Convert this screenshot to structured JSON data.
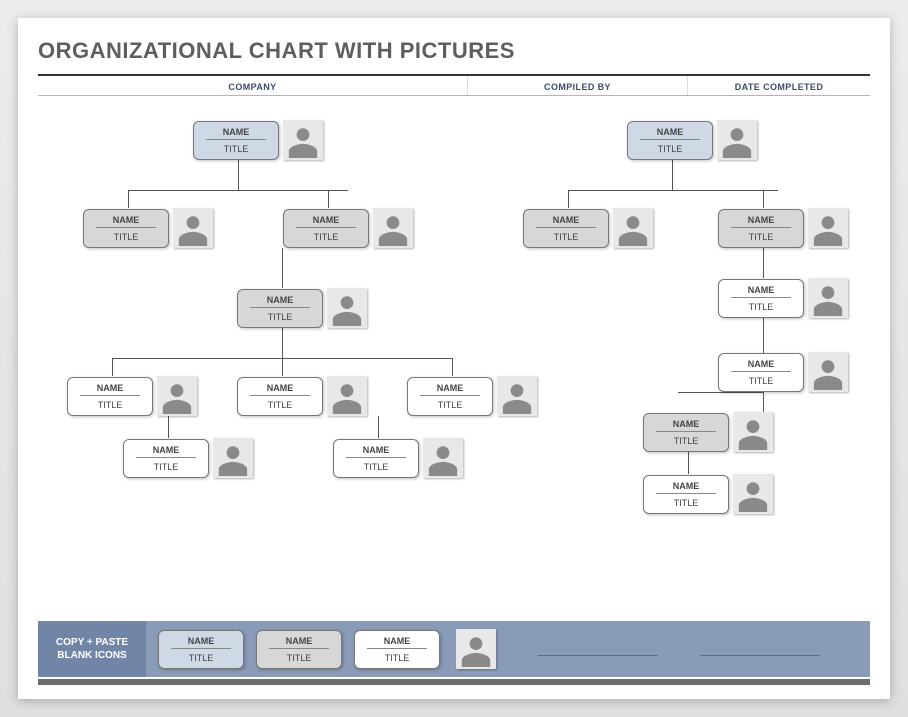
{
  "title": "ORGANIZATIONAL CHART WITH PICTURES",
  "header": {
    "company": "COMPANY",
    "compiled_by": "COMPILED BY",
    "date_completed": "DATE COMPLETED"
  },
  "labels": {
    "name": "NAME",
    "title": "TITLE"
  },
  "nodes": {
    "left_top": {
      "name": "NAME",
      "title": "TITLE"
    },
    "left_l2a": {
      "name": "NAME",
      "title": "TITLE"
    },
    "left_l2b": {
      "name": "NAME",
      "title": "TITLE"
    },
    "left_l3": {
      "name": "NAME",
      "title": "TITLE"
    },
    "left_l4a": {
      "name": "NAME",
      "title": "TITLE"
    },
    "left_l4b": {
      "name": "NAME",
      "title": "TITLE"
    },
    "left_l4c": {
      "name": "NAME",
      "title": "TITLE"
    },
    "left_l5a": {
      "name": "NAME",
      "title": "TITLE"
    },
    "left_l5b": {
      "name": "NAME",
      "title": "TITLE"
    },
    "right_top": {
      "name": "NAME",
      "title": "TITLE"
    },
    "right_l2a": {
      "name": "NAME",
      "title": "TITLE"
    },
    "right_l2b": {
      "name": "NAME",
      "title": "TITLE"
    },
    "right_l3": {
      "name": "NAME",
      "title": "TITLE"
    },
    "right_l4": {
      "name": "NAME",
      "title": "TITLE"
    },
    "right_l5": {
      "name": "NAME",
      "title": "TITLE"
    }
  },
  "footer": {
    "label": "COPY + PASTE BLANK ICONS",
    "blue": {
      "name": "NAME",
      "title": "TITLE"
    },
    "grey": {
      "name": "NAME",
      "title": "TITLE"
    },
    "white": {
      "name": "NAME",
      "title": "TITLE"
    }
  }
}
